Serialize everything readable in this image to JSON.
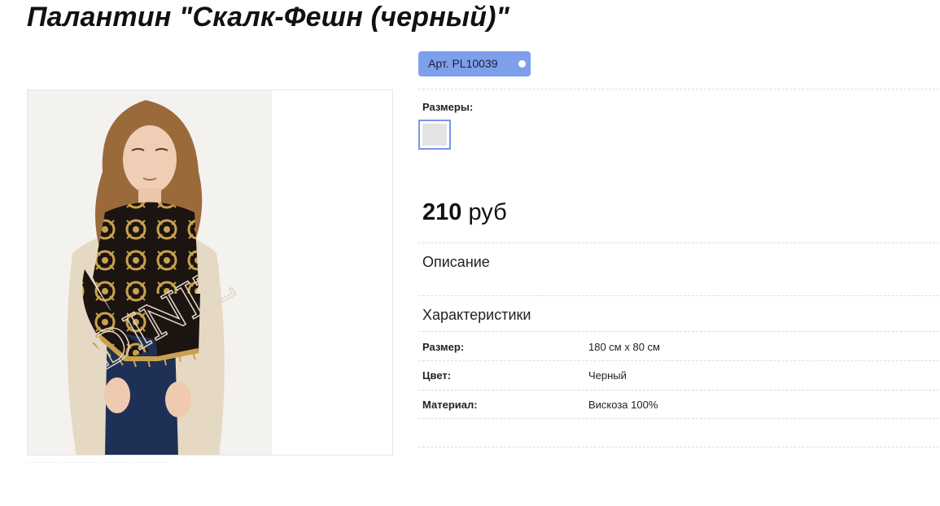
{
  "product": {
    "title": "Палантин \"Скалк-Фешн (черный)\"",
    "sku_label": "Арт. PL10039",
    "price_amount": "210",
    "price_currency": "руб"
  },
  "sizes": {
    "label": "Размеры:"
  },
  "sections": {
    "description": "Описание",
    "characteristics": "Характеристики"
  },
  "specs": [
    {
      "label": "Размер:",
      "value": "180 см x 80 см"
    },
    {
      "label": "Цвет:",
      "value": "Черный"
    },
    {
      "label": "Материал:",
      "value": "Вискоза 100%"
    }
  ],
  "image": {
    "watermark": "DINIZ"
  },
  "colors": {
    "sku_badge": "#7ea0ec",
    "size_swatch_border": "#7b96e6",
    "scarf_black": "#1c1410",
    "scarf_gold": "#c9a24e"
  },
  "icons": {
    "sku_indicator": "dot-icon"
  }
}
